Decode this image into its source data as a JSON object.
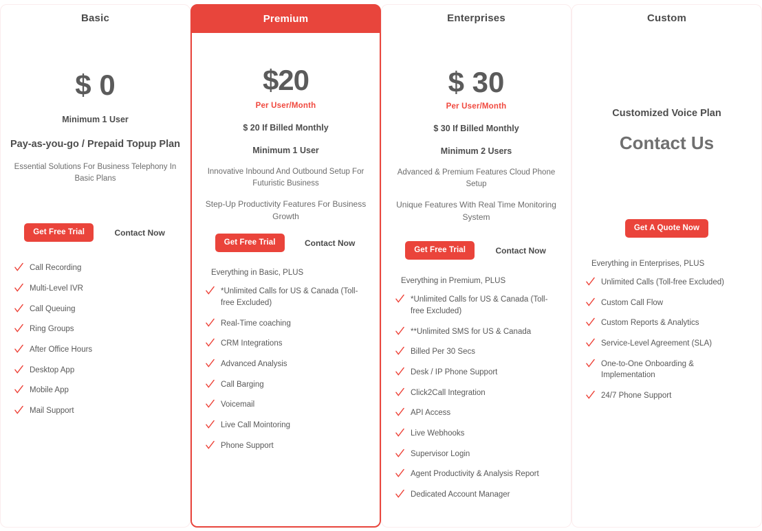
{
  "theme": {
    "accent": "#e8453c",
    "accent_button": "#ea443b",
    "text_dark": "#4d4d4d",
    "text_muted": "#6c6c6c",
    "card_border": "#fbeced",
    "check_color": "#ed4036"
  },
  "plans": [
    {
      "id": "basic",
      "name": "Basic",
      "featured": false,
      "price": "$ 0",
      "per_user": "",
      "billed": "",
      "minimum": "Minimum 1 User",
      "tagline_bold": "Pay-as-you-go / Prepaid Topup Plan",
      "tagline": "Essential Solutions For Business Telephony In Basic Plans",
      "tagline2": "",
      "contact_us": "",
      "primary_cta": "Get Free Trial",
      "secondary_cta": "Contact Now",
      "features_heading": "",
      "features": [
        "Call Recording",
        "Multi-Level IVR",
        "Call Queuing",
        "Ring Groups",
        "After Office Hours",
        "Desktop App",
        "Mobile App",
        "Mail Support"
      ]
    },
    {
      "id": "premium",
      "name": "Premium",
      "featured": true,
      "price": "$20",
      "per_user": "Per User/Month",
      "billed": "$ 20 If Billed Monthly",
      "minimum": "Minimum 1 User",
      "tagline_bold": "",
      "tagline": "Innovative Inbound And Outbound Setup For Futuristic Business",
      "tagline2": "Step-Up Productivity Features For Business Growth",
      "contact_us": "",
      "primary_cta": "Get Free Trial",
      "secondary_cta": "Contact Now",
      "features_heading": "Everything in Basic, PLUS",
      "features": [
        "*Unlimited Calls for US & Canada (Toll-free Excluded)",
        "Real-Time coaching",
        "CRM Integrations",
        "Advanced Analysis",
        "Call Barging",
        "Voicemail",
        "Live Call Mointoring",
        "Phone Support"
      ]
    },
    {
      "id": "enterprises",
      "name": "Enterprises",
      "featured": false,
      "price": "$ 30",
      "per_user": "Per User/Month",
      "billed": "$ 30 If Billed Monthly",
      "minimum": "Minimum 2 Users",
      "tagline_bold": "",
      "tagline": "Advanced & Premium Features Cloud Phone Setup",
      "tagline2": "Unique Features With Real Time Monitoring System",
      "contact_us": "",
      "primary_cta": "Get Free Trial",
      "secondary_cta": "Contact Now",
      "features_heading": "Everything in Premium, PLUS",
      "features": [
        "*Unlimited Calls for US & Canada (Toll-free Excluded)",
        "**Unlimited SMS for US & Canada",
        "Billed Per 30 Secs",
        "Desk / IP Phone Support",
        "Click2Call Integration",
        "API Access",
        "Live Webhooks",
        "Supervisor Login",
        "Agent Productivity & Analysis Report",
        "Dedicated Account Manager"
      ]
    },
    {
      "id": "custom",
      "name": "Custom",
      "featured": false,
      "price": "",
      "per_user": "",
      "billed": "",
      "minimum": "",
      "tagline_bold": "Customized Voice Plan",
      "tagline": "",
      "tagline2": "",
      "contact_us": "Contact Us",
      "primary_cta": "Get A Quote Now",
      "secondary_cta": "",
      "features_heading": "Everything in Enterprises, PLUS",
      "features": [
        "Unlimited Calls (Toll-free Excluded)",
        "Custom Call Flow",
        "Custom Reports & Analytics",
        "Service-Level Agreement (SLA)",
        "One-to-One Onboarding & Implementation",
        "24/7 Phone Support"
      ]
    }
  ]
}
